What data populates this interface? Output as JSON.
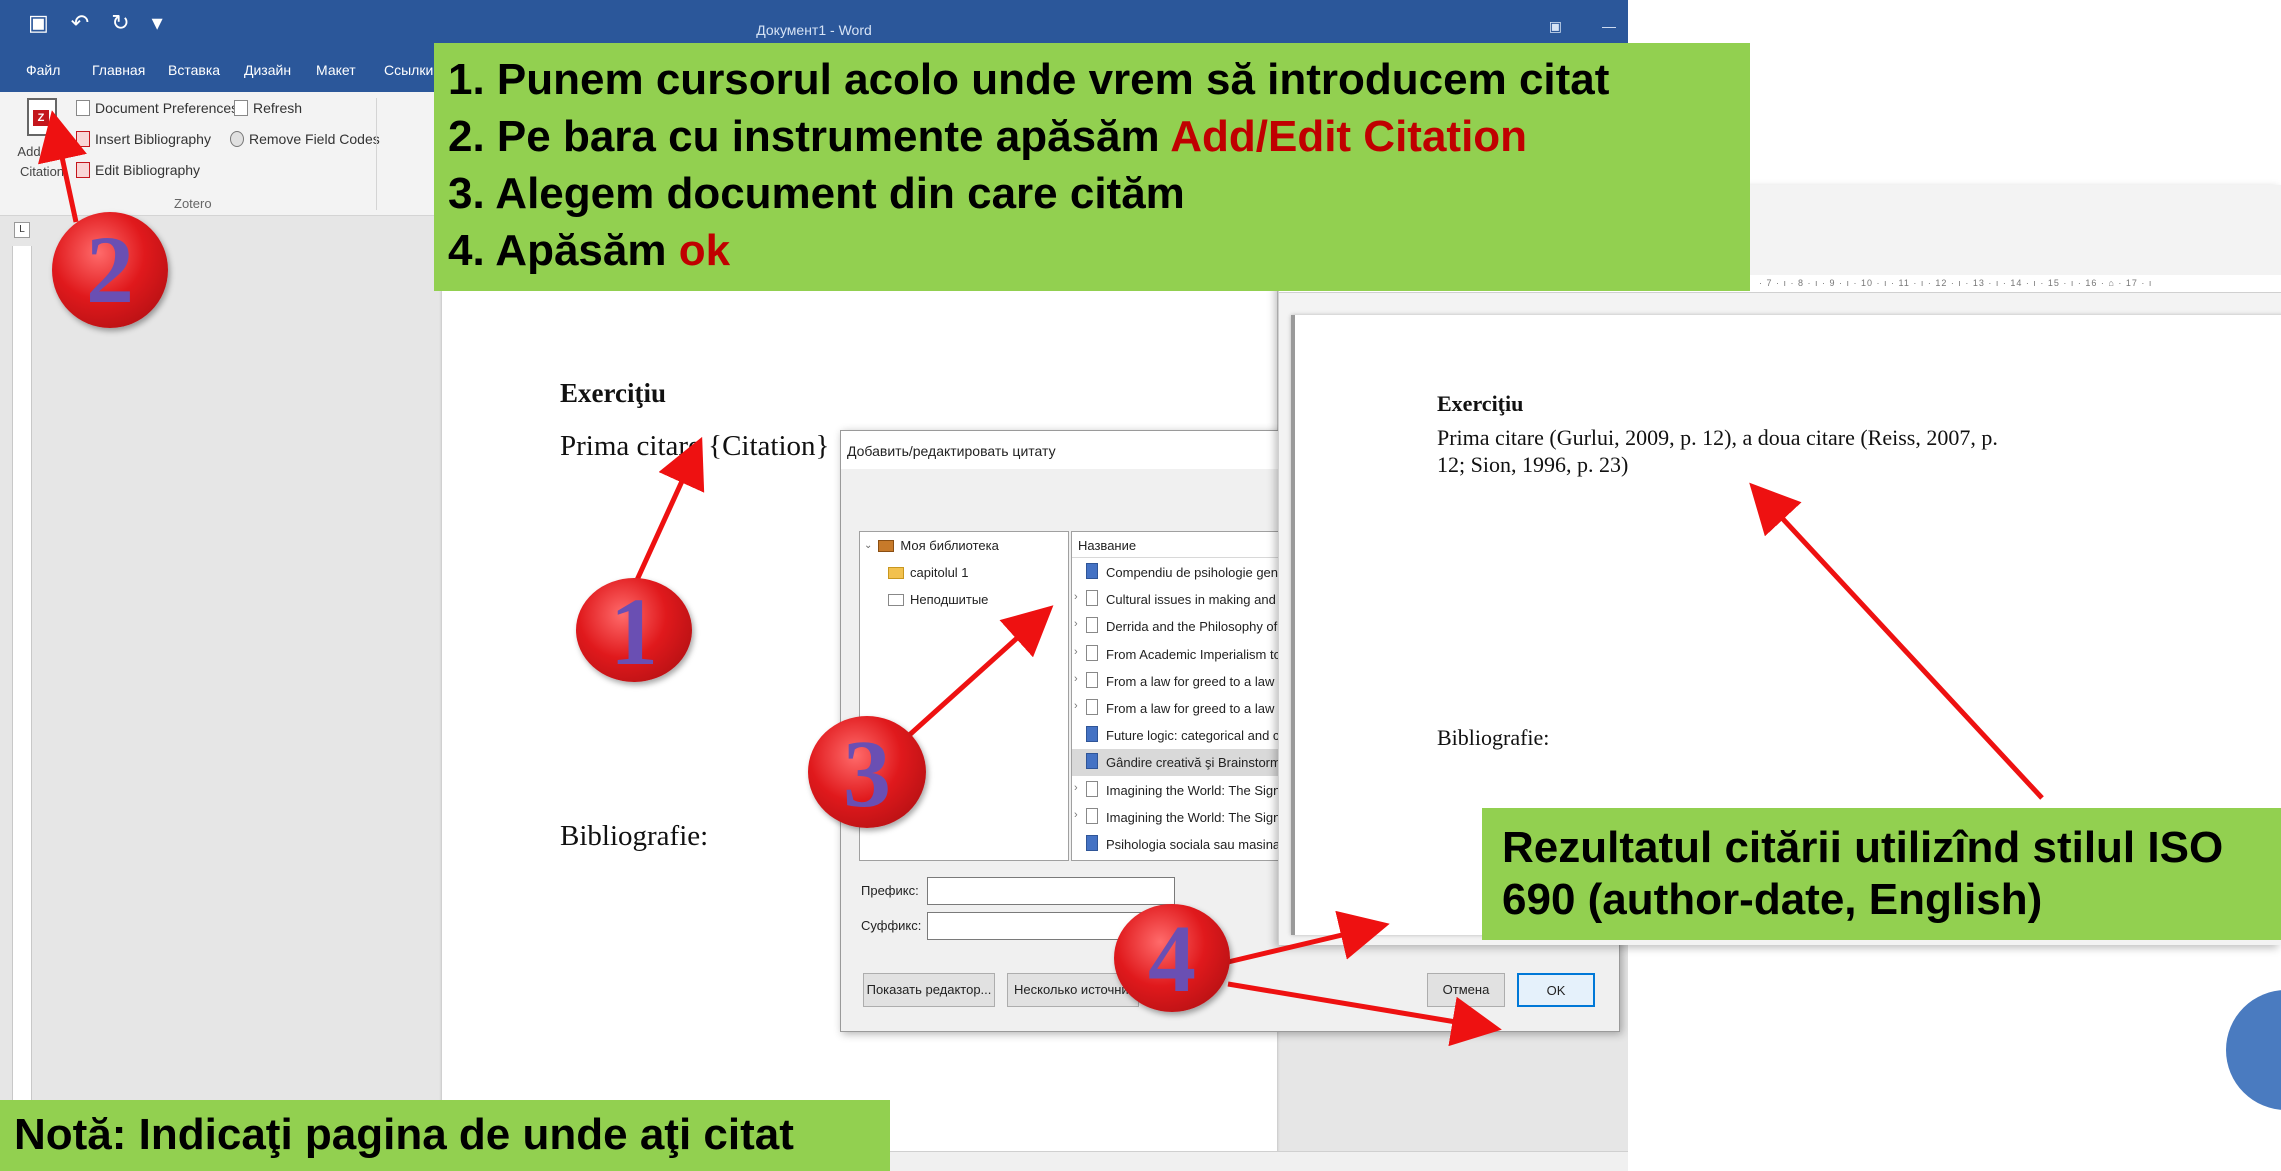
{
  "word": {
    "window_title": "Документ1 - Word",
    "tabs": [
      "Файл",
      "Главная",
      "Вставка",
      "Дизайн",
      "Макет",
      "Ссылки"
    ],
    "ribbon": {
      "add_edit_citation": "Add/Edit Citation",
      "document_preferences": "Document Preferences",
      "refresh": "Refresh",
      "insert_bibliography": "Insert Bibliography",
      "remove_field_codes": "Remove Field Codes",
      "edit_bibliography": "Edit Bibliography",
      "group_label": "Zotero"
    },
    "document": {
      "heading": "Exerciţiu",
      "line1": "Prima citare {Citation}",
      "bibliography": "Bibliografie:"
    }
  },
  "dialog": {
    "title": "Добавить/редактировать цитату",
    "tree": [
      "Моя библиотека",
      "capitolul 1",
      "Неподшитые"
    ],
    "items_header": "Название",
    "items": [
      {
        "label": "Compendiu de psihologie gene",
        "type": "book",
        "selected": false
      },
      {
        "label": "Cultural issues in making and u",
        "type": "doc",
        "selected": false
      },
      {
        "label": "Derrida and the Philosophy of L",
        "type": "doc",
        "selected": false
      },
      {
        "label": "From Academic Imperialism to",
        "type": "doc",
        "selected": false
      },
      {
        "label": "From a law for greed to a law fo",
        "type": "doc",
        "selected": false
      },
      {
        "label": "From a law for greed to a law fo",
        "type": "doc",
        "selected": false
      },
      {
        "label": "Future logic: categorical and co",
        "type": "book",
        "selected": false
      },
      {
        "label": "Gândire creativă şi Brainstormin",
        "type": "book",
        "selected": true
      },
      {
        "label": "Imagining the World: The Signif",
        "type": "doc",
        "selected": false
      },
      {
        "label": "Imagining the World: The Signif",
        "type": "doc",
        "selected": false
      },
      {
        "label": "Psihologia sociala sau masina d",
        "type": "book",
        "selected": false
      }
    ],
    "prefix_label": "Префикс:",
    "suffix_label": "Суффикс:",
    "show_editor_button": "Показать редактор...",
    "multiple_sources_button": "Несколько источни",
    "cancel_button": "Отмена",
    "ok_button": "OK"
  },
  "result_doc": {
    "heading": "Exerciţiu",
    "line1": "Prima citare (Gurlui, 2009, p. 12), a doua citare (Reiss, 2007, p.",
    "line2": "12; Sion, 1996, p. 23)",
    "bibliography": "Bibliografie:",
    "ruler": "· 7 · ı · 8 · ı · 9 · ı · 10 · ı · 11 · ı · 12 · ı · 13 · ı · 14 · ı · 15 · ı · 16 · ⌂ · 17 · ı"
  },
  "instructions": {
    "line1": "1. Punem cursorul acolo unde vrem să introducem citat",
    "line2_prefix": "2. Pe bara cu instrumente apăsăm ",
    "line2_highlight": "Add/Edit Citation",
    "line3": "3. Alegem document din care cităm",
    "line4_prefix": "4. Apăsăm ",
    "line4_highlight": "ok"
  },
  "result_callout": "Rezultatul citării utilizînd stilul ISO 690 (author-date, English)",
  "note": "Notă: Indicaţi pagina de unde aţi citat",
  "badges": [
    "1",
    "2",
    "3",
    "4"
  ],
  "colors": {
    "callout_green": "#92d050",
    "highlight_red": "#c00000",
    "word_blue": "#2b579a",
    "arrow_red": "#ee1111"
  }
}
